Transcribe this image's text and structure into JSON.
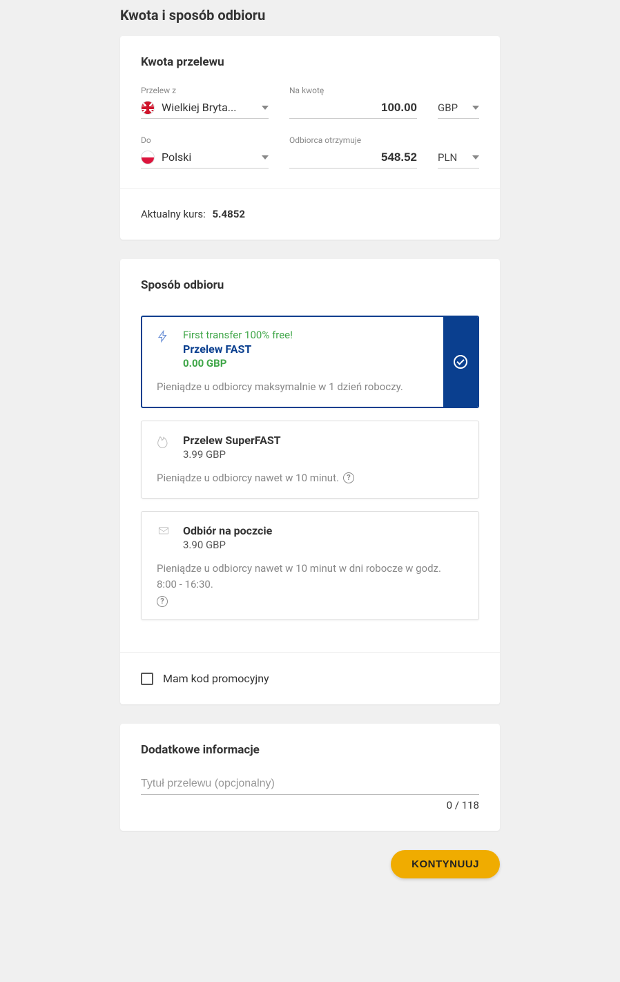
{
  "page_title": "Kwota i sposób odbioru",
  "amount_section": {
    "title": "Kwota przelewu",
    "from_label": "Przelew z",
    "from_country": "Wielkiej Bryta...",
    "amount_label": "Na kwotę",
    "amount_value": "100.00",
    "amount_currency": "GBP",
    "to_label": "Do",
    "to_country": "Polski",
    "receive_label": "Odbiorca otrzymuje",
    "receive_value": "548.52",
    "receive_currency": "PLN",
    "rate_label": "Aktualny kurs:",
    "rate_value": "5.4852"
  },
  "delivery_section": {
    "title": "Sposób odbioru",
    "options": [
      {
        "promo": "First transfer 100% free!",
        "name": "Przelew FAST",
        "price": "0.00 GBP",
        "desc": "Pieniądze u odbiorcy maksymalnie w 1 dzień roboczy.",
        "selected": true,
        "has_help": false,
        "icon": "bolt"
      },
      {
        "promo": "",
        "name": "Przelew SuperFAST",
        "price": "3.99 GBP",
        "desc": "Pieniądze u odbiorcy nawet w 10 minut.",
        "selected": false,
        "has_help": true,
        "icon": "fire"
      },
      {
        "promo": "",
        "name": "Odbiór na poczcie",
        "price": "3.90 GBP",
        "desc": "Pieniądze u odbiorcy nawet w 10 minut w dni robocze w godz. 8:00 - 16:30.",
        "selected": false,
        "has_help": true,
        "icon": "envelope"
      }
    ],
    "promo_checkbox_label": "Mam kod promocyjny"
  },
  "extra_section": {
    "title": "Dodatkowe informacje",
    "title_placeholder": "Tytuł przelewu (opcjonalny)",
    "counter": "0 / 118"
  },
  "continue_label": "KONTYNUUJ"
}
